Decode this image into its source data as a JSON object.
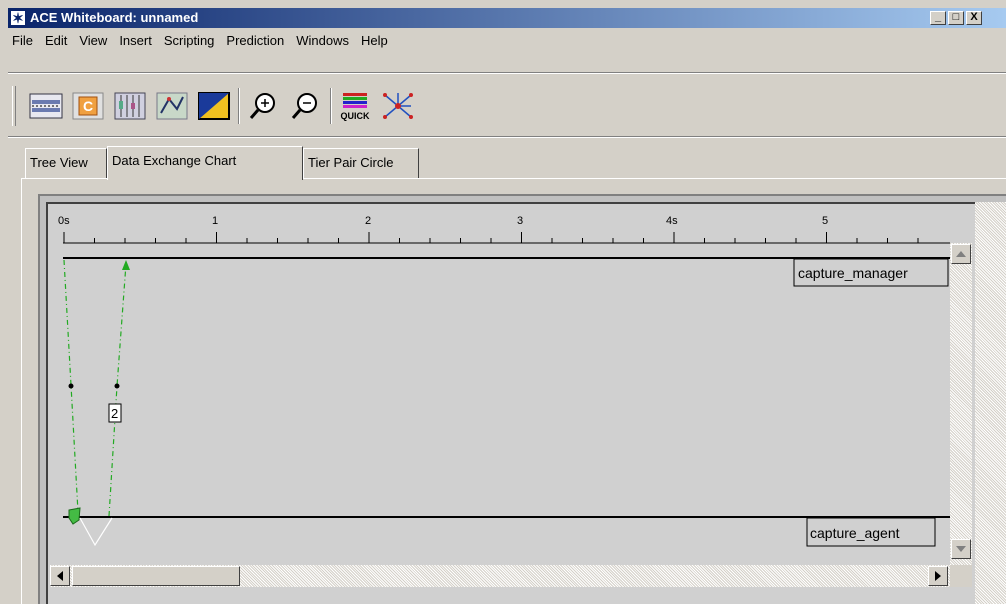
{
  "window": {
    "title": "ACE Whiteboard: unnamed",
    "controls": [
      "_",
      "□",
      "X"
    ]
  },
  "menu": [
    "File",
    "Edit",
    "View",
    "Insert",
    "Scripting",
    "Prediction",
    "Windows",
    "Help"
  ],
  "toolbar": {
    "buttons": [
      {
        "name": "network-view-icon"
      },
      {
        "name": "configure-icon",
        "label": "C"
      },
      {
        "name": "grid-view-icon"
      },
      {
        "name": "map-view-icon"
      },
      {
        "name": "color-split-icon"
      },
      {
        "name": "zoom-in-icon"
      },
      {
        "name": "zoom-out-icon"
      },
      {
        "name": "quick-icon",
        "label": "QUICK"
      },
      {
        "name": "network-star-icon"
      }
    ]
  },
  "tabs": [
    {
      "label": "Tree View",
      "active": false
    },
    {
      "label": "Data Exchange Chart",
      "active": true
    },
    {
      "label": "Tier Pair Circle",
      "active": false
    }
  ],
  "chart": {
    "axis": {
      "tick_labels": [
        "0s",
        "1",
        "2",
        "3",
        "4s",
        "5"
      ]
    },
    "tiers": [
      {
        "label": "capture_manager"
      },
      {
        "label": "capture_agent"
      }
    ],
    "exchange_label": "2",
    "colors": {
      "exchange": "#22aa22",
      "tier_line": "#000000"
    }
  }
}
